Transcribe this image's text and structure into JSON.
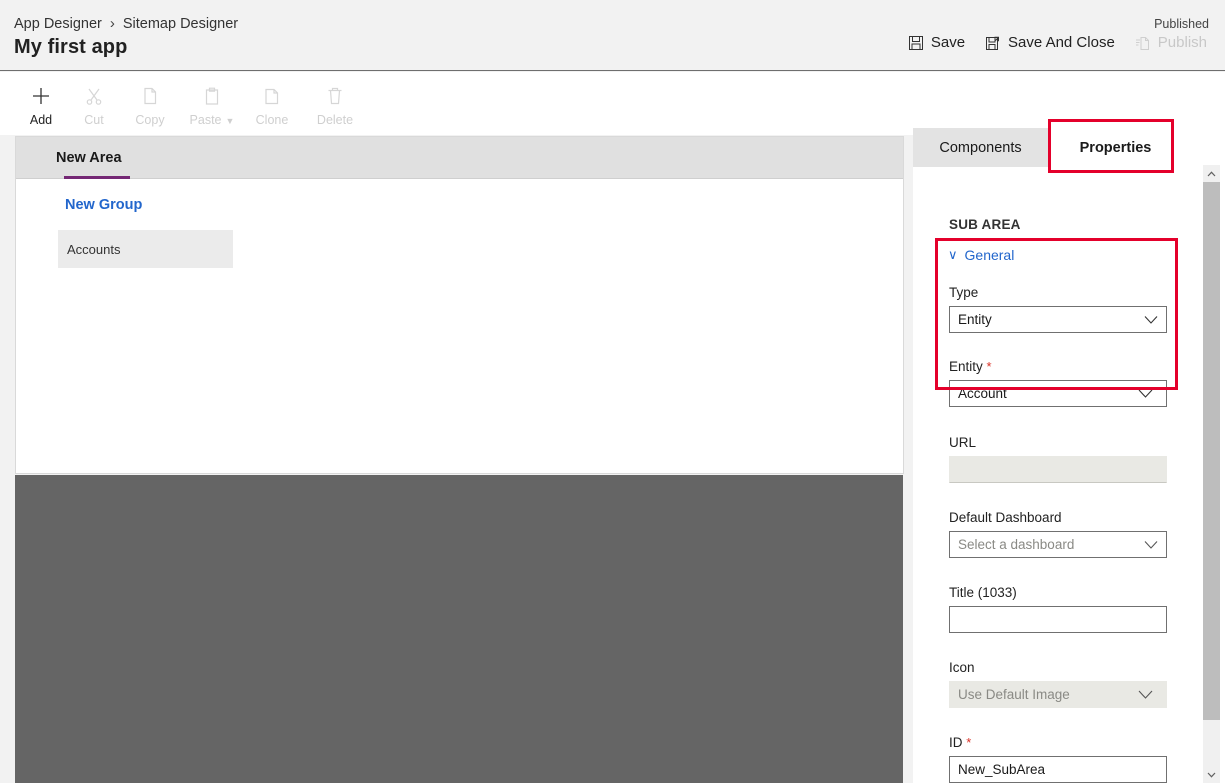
{
  "header": {
    "breadcrumb": {
      "parent": "App Designer",
      "separator": "›",
      "current": "Sitemap Designer"
    },
    "app_title": "My first app",
    "published_label": "Published",
    "actions": [
      {
        "label": "Save",
        "icon": "save-icon",
        "enabled": true
      },
      {
        "label": "Save And Close",
        "icon": "save-and-close-icon",
        "enabled": true
      },
      {
        "label": "Publish",
        "icon": "publish-icon",
        "enabled": false
      }
    ]
  },
  "toolbar": {
    "items": [
      {
        "label": "Add",
        "icon": "plus-icon",
        "enabled": true
      },
      {
        "label": "Cut",
        "icon": "scissors-icon",
        "enabled": false
      },
      {
        "label": "Copy",
        "icon": "copy-icon",
        "enabled": false
      },
      {
        "label": "Paste",
        "icon": "clipboard-icon",
        "enabled": false,
        "caret": "▼"
      },
      {
        "label": "Clone",
        "icon": "clone-icon",
        "enabled": false
      },
      {
        "label": "Delete",
        "icon": "trash-icon",
        "enabled": false
      }
    ]
  },
  "canvas": {
    "area_tab": "New Area",
    "group_title": "New Group",
    "subarea_item": "Accounts"
  },
  "panel": {
    "tabs": [
      {
        "label": "Components",
        "active": false
      },
      {
        "label": "Properties",
        "active": true
      }
    ],
    "section_title": "SUB AREA",
    "general_label": "General",
    "general_chevron": "∨",
    "fields": [
      {
        "name": "type",
        "label": "Type",
        "required": false,
        "kind": "select",
        "value": "Entity",
        "state": "enabled"
      },
      {
        "name": "entity",
        "label": "Entity",
        "required": true,
        "kind": "select",
        "value": "Account",
        "state": "enabled"
      },
      {
        "name": "url",
        "label": "URL",
        "required": false,
        "kind": "text",
        "value": "",
        "state": "disabled"
      },
      {
        "name": "default_dashboard",
        "label": "Default Dashboard",
        "required": false,
        "kind": "select",
        "value": "",
        "placeholder": "Select a dashboard",
        "state": "enabled"
      },
      {
        "name": "title",
        "label": "Title (1033)",
        "required": false,
        "kind": "text",
        "value": "",
        "state": "enabled"
      },
      {
        "name": "icon",
        "label": "Icon",
        "required": false,
        "kind": "select",
        "value": "Use Default Image",
        "state": "greyed"
      },
      {
        "name": "id",
        "label": "ID",
        "required": true,
        "kind": "text",
        "value": "New_SubArea",
        "state": "enabled"
      }
    ],
    "required_marker": "*"
  },
  "annotations": [
    {
      "name": "properties-tab-highlight",
      "color": "#e4002b"
    },
    {
      "name": "type-entity-highlight",
      "color": "#e4002b"
    }
  ],
  "scrollbar": {
    "up_arrow": "∧",
    "down_arrow": "∨"
  },
  "colors": {
    "accent_purple": "#742774",
    "link_blue": "#2266cc",
    "annotation_red": "#e4002b",
    "dark_strip": "#656565"
  }
}
